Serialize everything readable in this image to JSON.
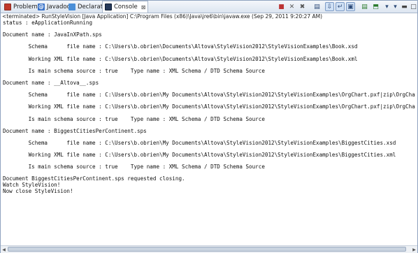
{
  "tabs": [
    {
      "label": "Problems",
      "icon": "problems-icon"
    },
    {
      "label": "Javadoc",
      "icon": "javadoc-icon"
    },
    {
      "label": "Declaration",
      "icon": "declaration-icon"
    },
    {
      "label": "Console",
      "icon": "console-icon",
      "close": "⊠"
    }
  ],
  "toolbar": {
    "buttons": [
      "terminate-icon",
      "remove-launch-icon",
      "remove-all-terminated-icon",
      "clear-console-icon",
      "scroll-lock-icon",
      "word-wrap-icon",
      "show-on-output-icon",
      "show-on-error-icon",
      "pin-console-icon",
      "display-selected-console-icon",
      "open-console-icon",
      "minimize-icon",
      "maximize-icon"
    ]
  },
  "info_line": "<terminated> RunStyleVision [Java Application] C:\\Program Files (x86)\\Java\\jre6\\bin\\javaw.exe (Sep 29, 2011 9:20:27 AM)",
  "console": {
    "lines": [
      "status : eApplicationRunning",
      "",
      "Document name : JavaInXPath.sps",
      "",
      "        Schema      file name : C:\\Users\\b.obrien\\Documents\\Altova\\StyleVision2012\\StyleVisionExamples\\Book.xsd",
      "",
      "        Working XML file name : C:\\Users\\b.obrien\\Documents\\Altova\\StyleVision2012\\StyleVisionExamples\\Book.xml",
      "",
      "        Is main schema source : true    Type name : XML Schema / DTD Schema Source",
      "",
      "Document name : __Altova__.sps",
      "",
      "        Schema      file name : C:\\Users\\b.obrien\\My Documents\\Altova\\StyleVision2012\\StyleVisionExamples\\OrgChart.pxf|zip\\OrgChart.xsd",
      "",
      "        Working XML file name : C:\\Users\\b.obrien\\My Documents\\Altova\\StyleVision2012\\StyleVisionExamples\\OrgChart.pxf|zip\\OrgChart.xml",
      "",
      "        Is main schema source : true    Type name : XML Schema / DTD Schema Source",
      "",
      "Document name : BiggestCitiesPerContinent.sps",
      "",
      "        Schema      file name : C:\\Users\\b.obrien\\My Documents\\Altova\\StyleVision2012\\StyleVisionExamples\\BiggestCities.xsd",
      "",
      "        Working XML file name : C:\\Users\\b.obrien\\My Documents\\Altova\\StyleVision2012\\StyleVisionExamples\\BiggestCities.xml",
      "",
      "        Is main schema source : true    Type name : XML Schema / DTD Schema Source",
      "",
      "Document BiggestCitiesPerContinent.sps requested closing.",
      "Watch StyleVision!",
      "Now close StyleVision!"
    ]
  }
}
